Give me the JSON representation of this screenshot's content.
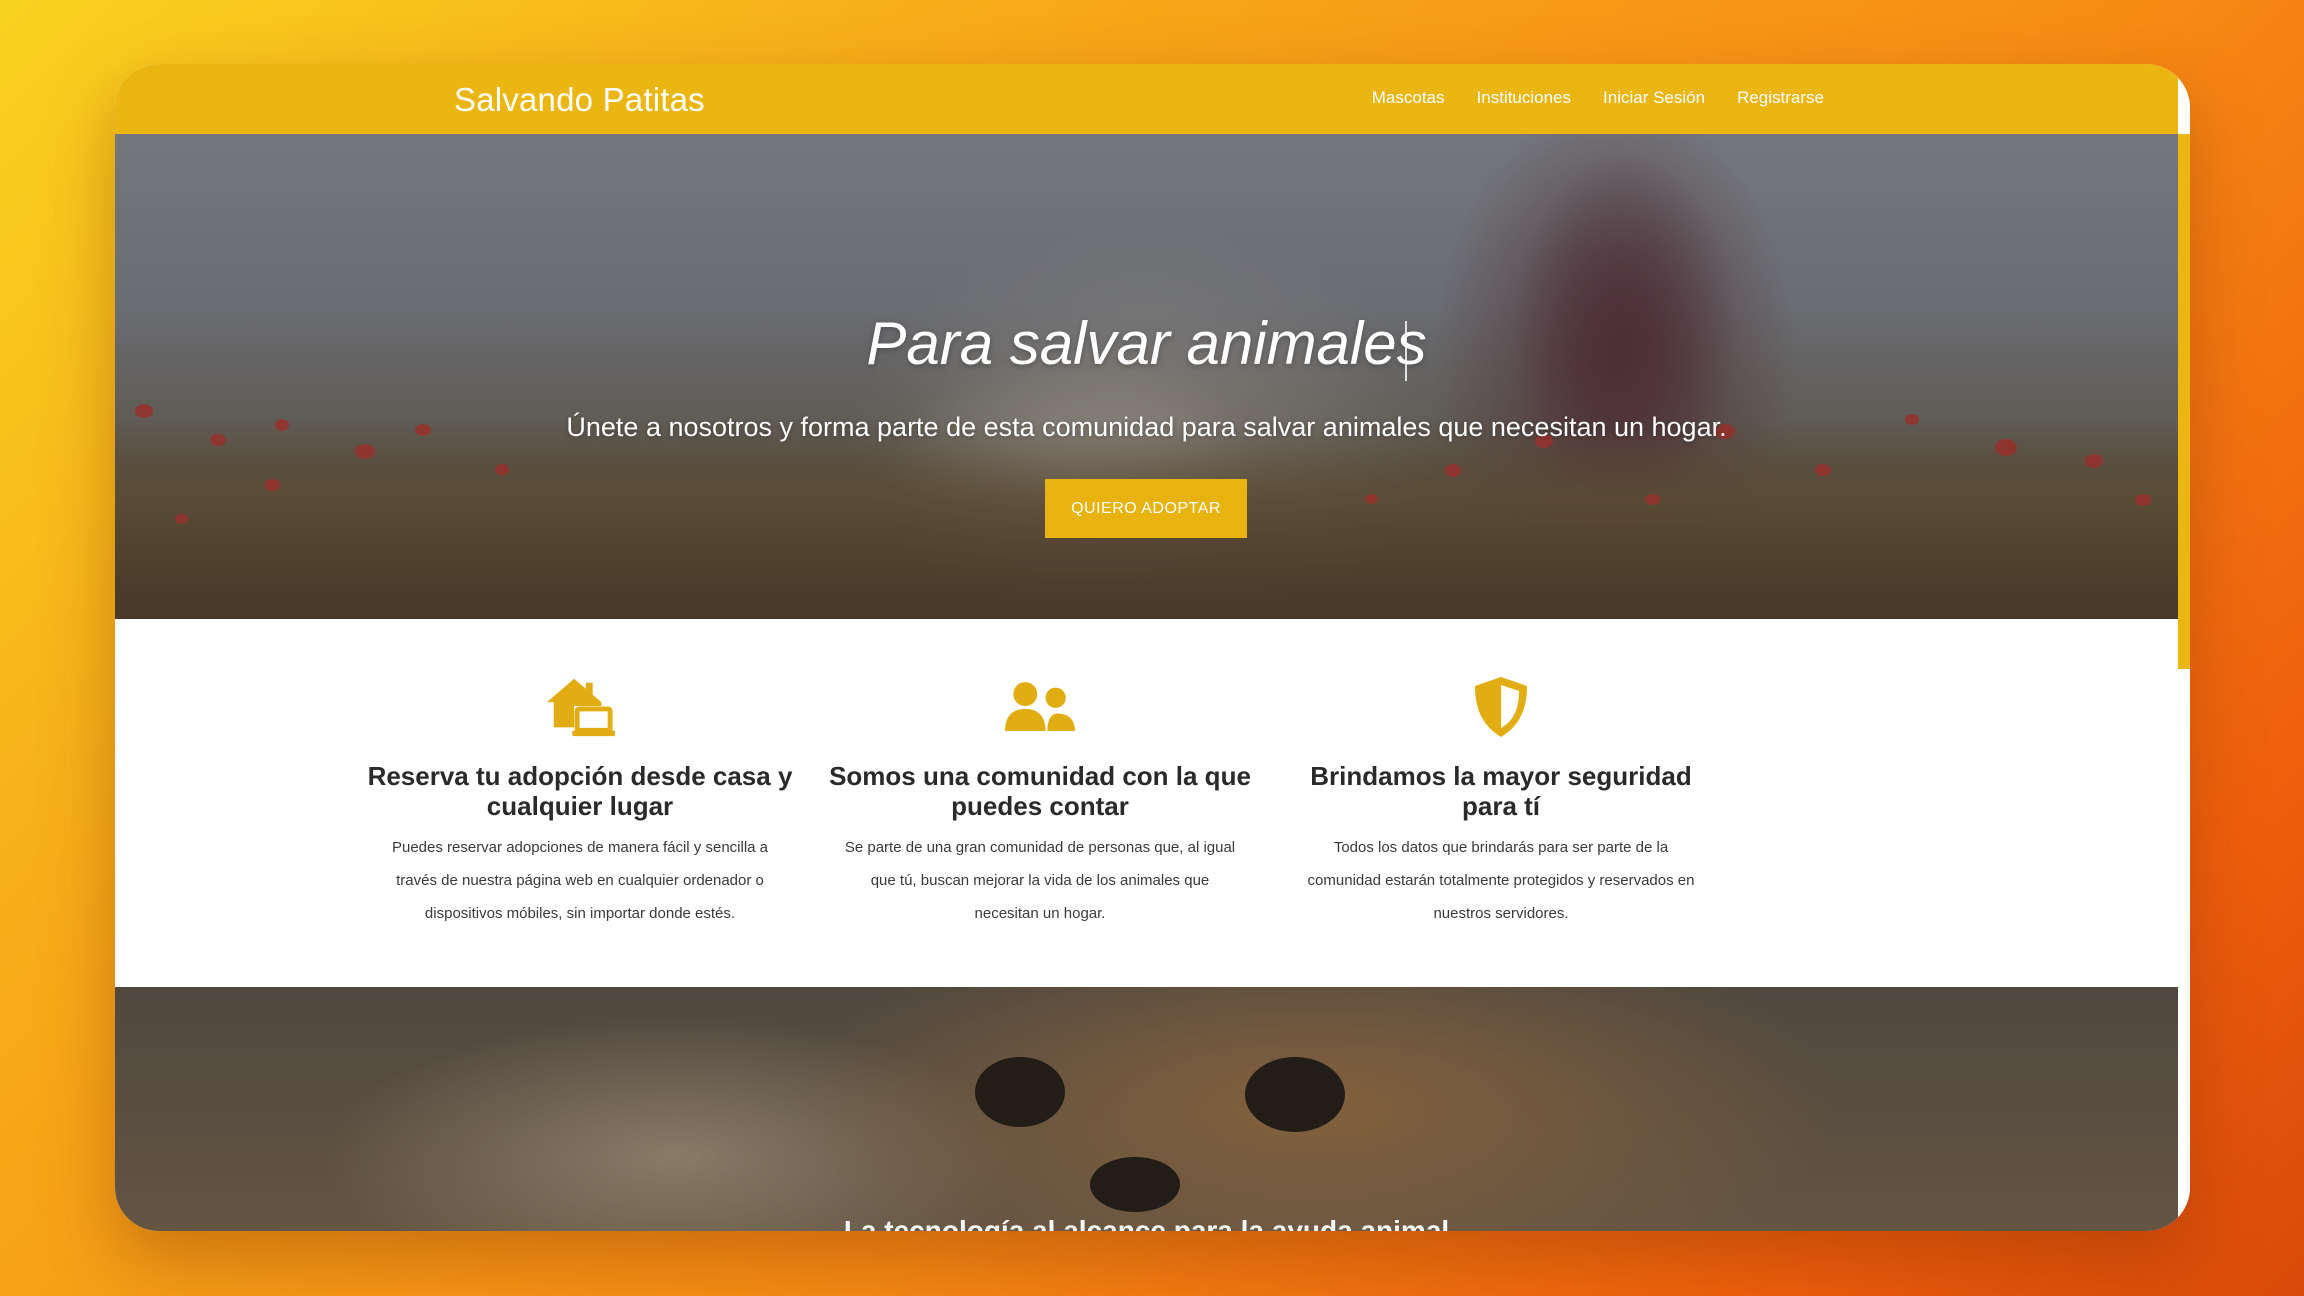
{
  "navbar": {
    "brand": "Salvando Patitas",
    "links": [
      "Mascotas",
      "Instituciones",
      "Iniciar Sesión",
      "Registrarse"
    ]
  },
  "hero": {
    "title": "Para salvar animales",
    "subtitle": "Únete a nosotros y forma parte de esta comunidad para salvar animales que necesitan un hogar.",
    "button_label": "QUIERO ADOPTAR"
  },
  "features": [
    {
      "icon": "house-laptop-icon",
      "title": "Reserva tu adopción desde casa y cualquier lugar",
      "text": "Puedes reservar adopciones de manera fácil y sencilla a través de nuestra página web en cualquier ordenador o dispositivos móbiles, sin importar donde estés."
    },
    {
      "icon": "users-icon",
      "title": "Somos una comunidad con la que puedes contar",
      "text": "Se parte de una gran comunidad de personas que, al igual que tú, buscan mejorar la vida de los animales que necesitan un hogar."
    },
    {
      "icon": "shield-icon",
      "title": "Brindamos la mayor seguridad para tí",
      "text": "Todos los datos que brindarás para ser parte de la comunidad estarán totalmente protegidos y reservados en nuestros servidores."
    }
  ],
  "lower_section": {
    "heading": "La tecnología al alcance para la ayuda animal"
  },
  "colors": {
    "accent": "#ebb612",
    "button": "#e8b20f",
    "icon": "#e2ad12"
  }
}
